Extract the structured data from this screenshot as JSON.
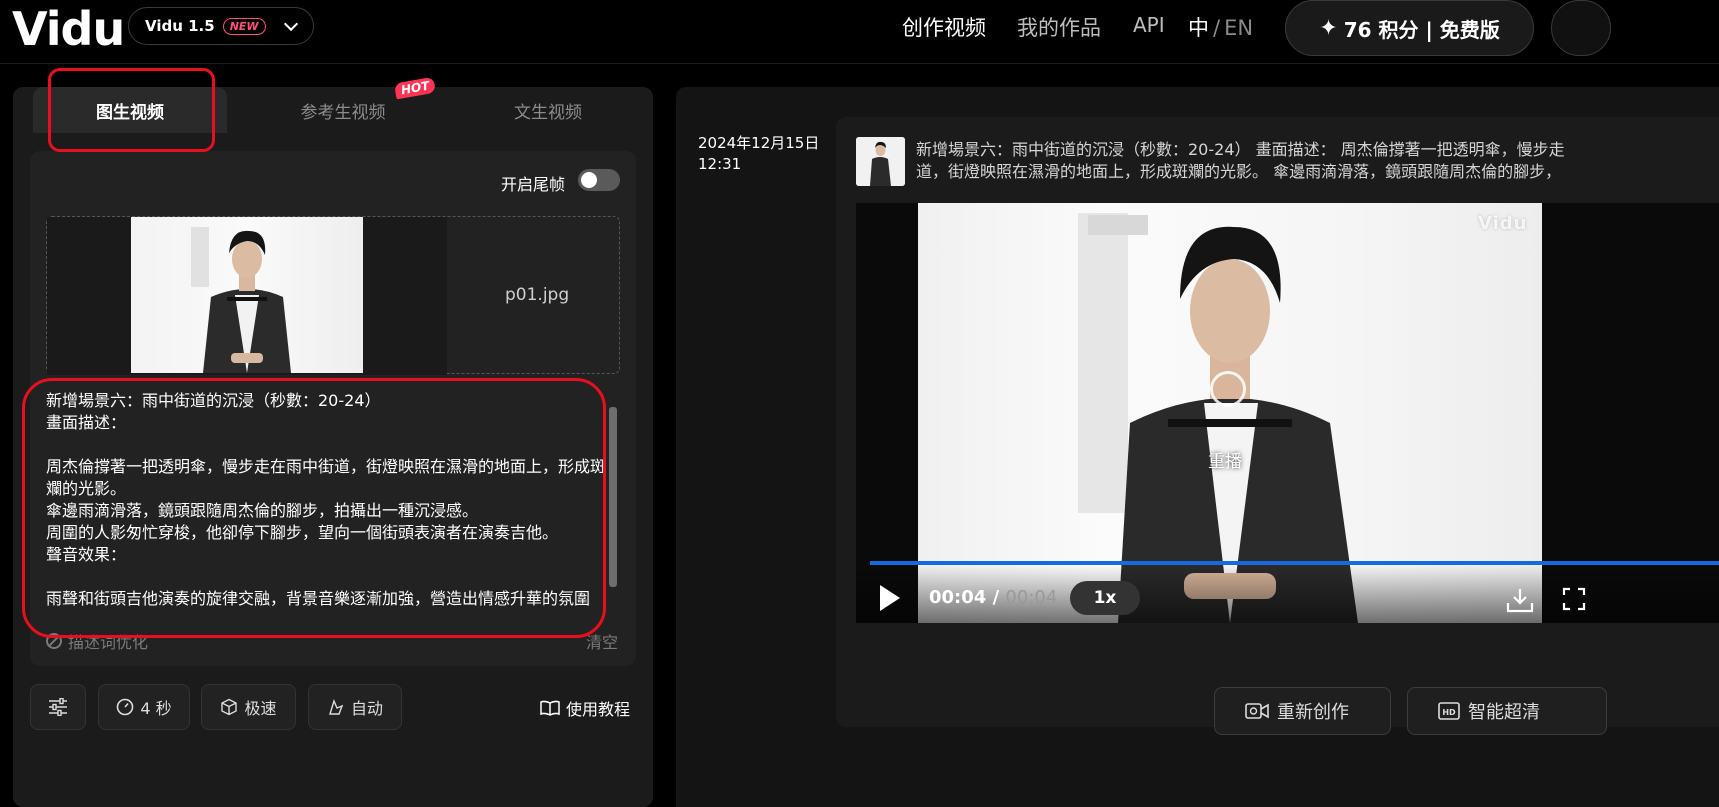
{
  "header": {
    "logo": "Vidu",
    "version": "Vidu 1.5",
    "new_badge": "NEW",
    "nav": {
      "create": "创作视频",
      "works": "我的作品",
      "api": "API",
      "lang_zh": "中",
      "lang_sep": "/",
      "lang_en": "EN"
    },
    "credits": "76 积分 | 免费版"
  },
  "left": {
    "tabs": {
      "image_to_video": "图生视频",
      "reference_to_video": "参考生视频",
      "text_to_video": "文生视频"
    },
    "hot_badge": "HOT",
    "tail_frame_label": "开启尾帧",
    "tail_frame_on": false,
    "file_name": "p01.jpg",
    "prompt": "新增場景六：雨中街道的沉浸（秒數：20-24）\n畫面描述：\n\n周杰倫撐著一把透明傘，慢步走在雨中街道，街燈映照在濕滑的地面上，形成斑斕的光影。\n傘邊雨滴滑落，鏡頭跟隨周杰倫的腳步，拍攝出一種沉浸感。\n周圍的人影匆忙穿梭，他卻停下腳步，望向一個街頭表演者在演奏吉他。\n聲音效果：\n\n雨聲和街頭吉他演奏的旋律交融，背景音樂逐漸加強，營造出情感升華的氛圍",
    "optimize_label": "描述词优化",
    "clear_label": "清空",
    "duration": "4 秒",
    "speed_mode": "极速",
    "motion_mode": "自动",
    "tutorial": "使用教程"
  },
  "right": {
    "date": "2024年12月15日",
    "time": "12:31",
    "record_prompt_line1": "新增場景六：雨中街道的沉浸（秒數：20-24） 畫面描述： 周杰倫撐著一把透明傘，慢步走",
    "record_prompt_line2": "道，街燈映照在濕滑的地面上，形成斑斕的光影。 傘邊雨滴滑落，鏡頭跟隨周杰倫的腳步，",
    "watermark": "Vidu",
    "replay_label": "重播",
    "current_time": "00:04",
    "time_sep": " / ",
    "duration": "00:04",
    "playback_speed": "1x",
    "progress": 1.0,
    "redo_button": "重新创作",
    "hd_button": "智能超清"
  },
  "colors": {
    "annotation": "#e8101e",
    "progress": "#1769e0",
    "new_badge": "#ff4f7a"
  }
}
